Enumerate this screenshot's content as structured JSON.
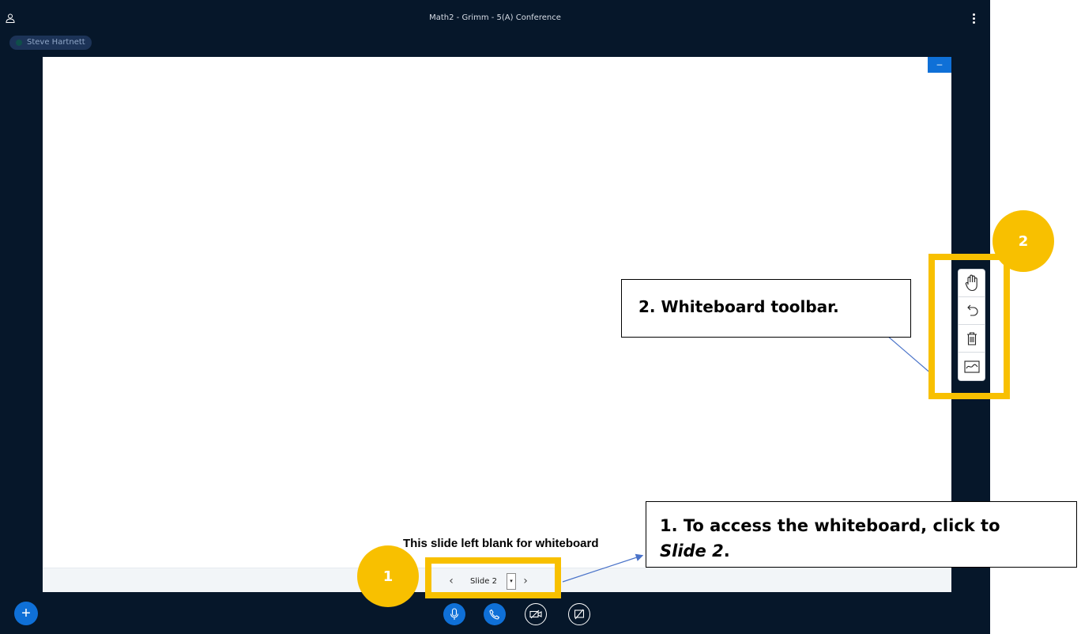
{
  "header": {
    "title": "Math2 - Grimm - 5(A) Conference"
  },
  "participant": {
    "name": "Steve Hartnett"
  },
  "presentation": {
    "minimize_label": "–",
    "slide_caption": "This slide left blank for whiteboard",
    "current_slide": "Slide 2",
    "prev_glyph": "‹",
    "next_glyph": "›",
    "dropdown_glyph": "▾"
  },
  "whiteboard_toolbar": {
    "tools": [
      "hand-tool",
      "undo",
      "clear-all",
      "multi-user"
    ]
  },
  "controls": {
    "add": "+",
    "buttons": [
      "microphone",
      "phone",
      "camera-off",
      "screenshare-off"
    ]
  },
  "annotations": {
    "badge1": "1",
    "badge2": "2",
    "callout1_line1": "1. To access the whiteboard, click to",
    "callout1_line2": "Slide 2",
    "callout1_suffix": ".",
    "callout2": "2. Whiteboard toolbar."
  },
  "colors": {
    "app_bg": "#06172a",
    "accent_blue": "#0f70d7",
    "highlight_yellow": "#f8c000",
    "arrow": "#4a73c9"
  }
}
